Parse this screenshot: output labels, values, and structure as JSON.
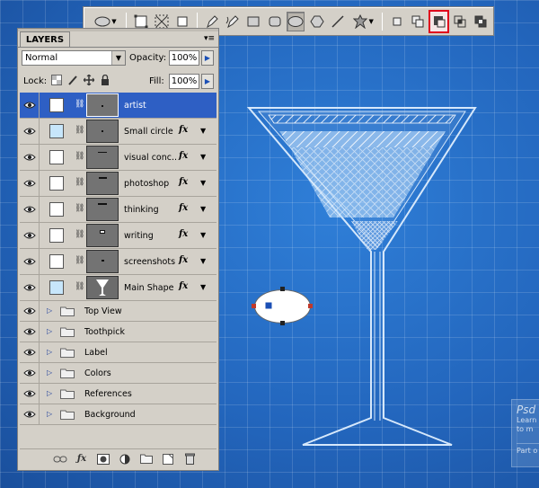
{
  "toolbar": {
    "tools": [
      {
        "icon": "ellipse-preset-icon",
        "dropdown": true
      },
      {
        "icon": "shape-layers-icon"
      },
      {
        "icon": "paths-icon"
      },
      {
        "icon": "fill-pixels-icon"
      },
      {
        "icon": "pen-tool-icon"
      },
      {
        "icon": "freeform-pen-icon"
      },
      {
        "icon": "rectangle-tool-icon"
      },
      {
        "icon": "rounded-rectangle-tool-icon"
      },
      {
        "icon": "ellipse-tool-icon",
        "active": true
      },
      {
        "icon": "polygon-tool-icon"
      },
      {
        "icon": "line-tool-icon"
      },
      {
        "icon": "custom-shape-tool-icon",
        "dropdown": true
      },
      {
        "icon": "create-new-shape-icon"
      },
      {
        "icon": "add-to-shape-area-icon"
      },
      {
        "icon": "subtract-from-shape-area-icon",
        "highlighted": true
      },
      {
        "icon": "intersect-shape-areas-icon"
      },
      {
        "icon": "exclude-overlapping-shape-areas-icon"
      }
    ],
    "highlight_color": "#e0001b"
  },
  "layers_panel": {
    "tab_label": "LAYERS",
    "blend_mode": "Normal",
    "opacity_label": "Opacity:",
    "opacity_value": "100%",
    "lock_label": "Lock:",
    "fill_label": "Fill:",
    "fill_value": "100%",
    "layers": [
      {
        "name": "artist",
        "selected": true,
        "fx": false
      },
      {
        "name": "Small circle",
        "fx": true
      },
      {
        "name": "visual conc...",
        "fx": true
      },
      {
        "name": "photoshop",
        "fx": true
      },
      {
        "name": "thinking",
        "fx": true
      },
      {
        "name": "writing",
        "fx": true
      },
      {
        "name": "screenshots",
        "fx": true
      },
      {
        "name": "Main Shape",
        "fx": true
      }
    ],
    "groups": [
      {
        "name": "Top View"
      },
      {
        "name": "Toothpick"
      },
      {
        "name": "Label"
      },
      {
        "name": "Colors"
      },
      {
        "name": "References"
      },
      {
        "name": "Background"
      }
    ],
    "fx_label": "fx",
    "footer_icons": [
      "link-layers-icon",
      "add-layer-style-icon",
      "add-mask-icon",
      "adjustment-layer-icon",
      "new-group-icon",
      "new-layer-icon",
      "delete-layer-icon"
    ]
  },
  "watermark": {
    "title": "Psd",
    "line1": "Learn",
    "line2": "to m",
    "part": "Part o"
  },
  "colors": {
    "canvas_blue": "#2a6fc6",
    "selection_blue": "#2e5fc4",
    "panel_gray": "#d4d0c8"
  }
}
